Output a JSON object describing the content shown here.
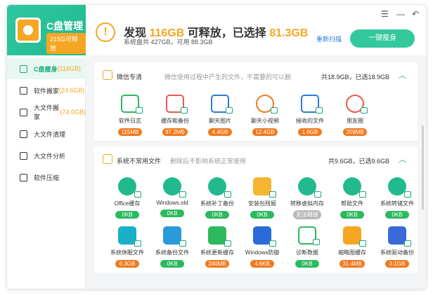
{
  "brand": {
    "title": "C盘管理",
    "badge": "215G可释放"
  },
  "nav": [
    {
      "label": "C盘瘦身",
      "sub": "(116GB)",
      "icon": "document-icon",
      "active": true
    },
    {
      "label": "软件搬家",
      "sub": "(24.6GB)",
      "icon": "truck-icon",
      "active": false
    },
    {
      "label": "大文件搬家",
      "sub": "(74.0GB)",
      "icon": "move-file-icon",
      "active": false
    },
    {
      "label": "大文件清理",
      "sub": "",
      "icon": "broom-icon",
      "active": false
    },
    {
      "label": "大文件分析",
      "sub": "",
      "icon": "chart-icon",
      "active": false
    },
    {
      "label": "软件压缩",
      "sub": "",
      "icon": "grid-icon",
      "active": false
    }
  ],
  "header": {
    "main_prefix": "发现",
    "main_found": "116GB",
    "main_mid": "可释放，已选择",
    "main_selected": "81.3GB",
    "sub": "系统盘共 427GB，可用 88.3GB",
    "rescan": "重新扫描",
    "slim_button": "一键瘦身"
  },
  "window_controls": {
    "menu": "☰",
    "minimize": "—",
    "back": "↶"
  },
  "wechat": {
    "title": "微信专清",
    "desc": "微信使用过程中产生的文件，不需要的可以删",
    "summary": "共18.9GB，已选18.9GB",
    "items": [
      {
        "label": "软件日志",
        "size": "115MB",
        "icon": "log-icon",
        "color": "#2db95f",
        "style": "outline",
        "size_color": "orange"
      },
      {
        "label": "缓存和备份",
        "size": "97.2MB",
        "icon": "layers-icon",
        "color": "#e85a4f",
        "style": "outline",
        "size_color": "orange"
      },
      {
        "label": "聊天图片",
        "size": "4.4GB",
        "icon": "image-icon",
        "color": "#2a7ad9",
        "style": "outline",
        "size_color": "orange"
      },
      {
        "label": "聊天小视频",
        "size": "12.4GB",
        "icon": "play-icon",
        "color": "#f07a1f",
        "style": "outline-circle",
        "size_color": "orange"
      },
      {
        "label": "接收的文件",
        "size": "1.6GB",
        "icon": "folder-download-icon",
        "color": "#2a7ad9",
        "style": "outline",
        "size_color": "orange"
      },
      {
        "label": "朋友圈",
        "size": "209MB",
        "icon": "aperture-icon",
        "color": "#e85a4f",
        "style": "outline-circle",
        "size_color": "orange"
      }
    ]
  },
  "system": {
    "title": "系统不常用文件",
    "desc": "删除后不影响系统正常使用",
    "summary": "共9.6GB，已选9.6GB",
    "items": [
      {
        "label": "Office缓存",
        "size": "0KB",
        "icon": "office-icon",
        "color": "#22b98f",
        "style": "circle",
        "size_color": "green"
      },
      {
        "label": "Windows.old",
        "size": "0KB",
        "icon": "windows-old-icon",
        "color": "#22b98f",
        "style": "circle",
        "size_color": "green"
      },
      {
        "label": "系统补丁备份",
        "size": "0KB",
        "icon": "patch-icon",
        "color": "#22b98f",
        "style": "circle",
        "size_color": "green"
      },
      {
        "label": "安装包残留",
        "size": "0KB",
        "icon": "package-icon",
        "color": "#f5b532",
        "style": "box",
        "size_color": "green"
      },
      {
        "label": "转移虚拟内存",
        "size": "无法释放",
        "icon": "save-icon",
        "color": "#22b98f",
        "style": "circle",
        "size_color": "gray"
      },
      {
        "label": "帮助文件",
        "size": "0KB",
        "icon": "help-icon",
        "color": "#22b98f",
        "style": "circle",
        "size_color": "green"
      },
      {
        "label": "系统转储文件",
        "size": "0KB",
        "icon": "download-icon",
        "color": "#22b98f",
        "style": "circle",
        "size_color": "green"
      },
      {
        "label": "系统休眠文件",
        "size": "6.3GB",
        "icon": "sleep-icon",
        "color": "#1ab0c8",
        "style": "box",
        "size_color": "orange"
      },
      {
        "label": "系统备份文件",
        "size": "0KB",
        "icon": "clock-icon",
        "color": "#2a9ad9",
        "style": "box",
        "size_color": "green"
      },
      {
        "label": "系统更新缓存",
        "size": "240MB",
        "icon": "update-icon",
        "color": "#2db95f",
        "style": "box",
        "size_color": "orange"
      },
      {
        "label": "Windows防御",
        "size": "4.6KB",
        "icon": "shield-icon",
        "color": "#2a6ad9",
        "style": "shield",
        "size_color": "orange"
      },
      {
        "label": "诊断数据",
        "size": "0KB",
        "icon": "diagnostics-icon",
        "color": "#2db95f",
        "style": "outline",
        "size_color": "green"
      },
      {
        "label": "缩略图缓存",
        "size": "31.4MB",
        "icon": "thumbnail-icon",
        "color": "#f5a623",
        "style": "box",
        "size_color": "orange"
      },
      {
        "label": "系统驱动备份",
        "size": "3.1GB",
        "icon": "driver-icon",
        "color": "#3a6ad9",
        "style": "box",
        "size_color": "orange"
      }
    ]
  }
}
